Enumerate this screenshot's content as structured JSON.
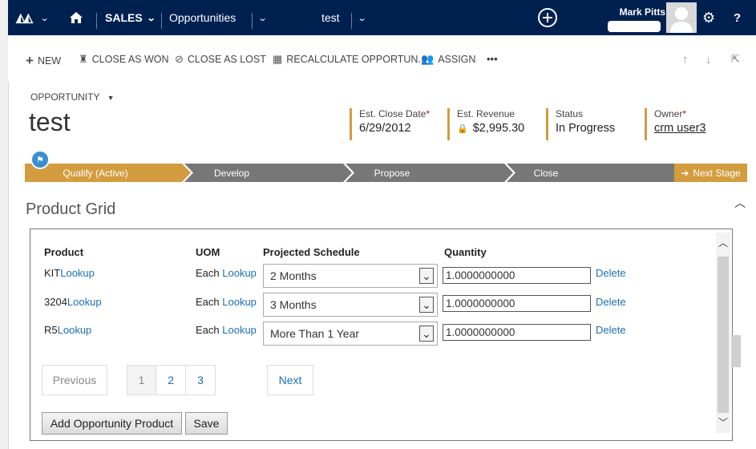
{
  "nav": {
    "module": "SALES",
    "area": "Opportunities",
    "record": "test",
    "user_name": "Mark Pitts"
  },
  "commands": {
    "new": "NEW",
    "close_won": "CLOSE AS WON",
    "close_lost": "CLOSE AS LOST",
    "recalculate": "RECALCULATE OPPORTUN...",
    "assign": "ASSIGN",
    "more": "•••"
  },
  "header": {
    "entity": "OPPORTUNITY",
    "title": "test",
    "fields": [
      {
        "label": "Est. Close Date",
        "value": "6/29/2012",
        "required": "*"
      },
      {
        "label": "Est. Revenue",
        "value": "$2,995.30"
      },
      {
        "label": "Status",
        "value": "In Progress"
      },
      {
        "label": "Owner",
        "value": "crm user3",
        "required": "*"
      }
    ]
  },
  "process": {
    "stages": [
      "Qualify (Active)",
      "Develop",
      "Propose",
      "Close"
    ],
    "next_label": "Next Stage"
  },
  "grid": {
    "section_title": "Product Grid",
    "columns": [
      "Product",
      "UOM",
      "Projected Schedule",
      "Quantity"
    ],
    "rows": [
      {
        "product": "KIT",
        "product_link": "Lookup",
        "uom": "Each",
        "uom_link": "Lookup",
        "schedule": "2 Months",
        "quantity": "1.0000000000",
        "delete": "Delete"
      },
      {
        "product": "3204",
        "product_link": "Lookup",
        "uom": "Each",
        "uom_link": "Lookup",
        "schedule": "3 Months",
        "quantity": "1.0000000000",
        "delete": "Delete"
      },
      {
        "product": "R5",
        "product_link": "Lookup",
        "uom": "Each",
        "uom_link": "Lookup",
        "schedule": "More Than 1 Year",
        "quantity": "1.0000000000",
        "delete": "Delete"
      }
    ],
    "pager": {
      "previous": "Previous",
      "pages": [
        "1",
        "2",
        "3"
      ],
      "next": "Next"
    },
    "add_button": "Add Opportunity Product",
    "save_button": "Save"
  },
  "colors": {
    "nav_bg": "#002050",
    "active_stage": "#d39c3e",
    "inactive_stage": "#777777",
    "link": "#1c6fb3"
  }
}
